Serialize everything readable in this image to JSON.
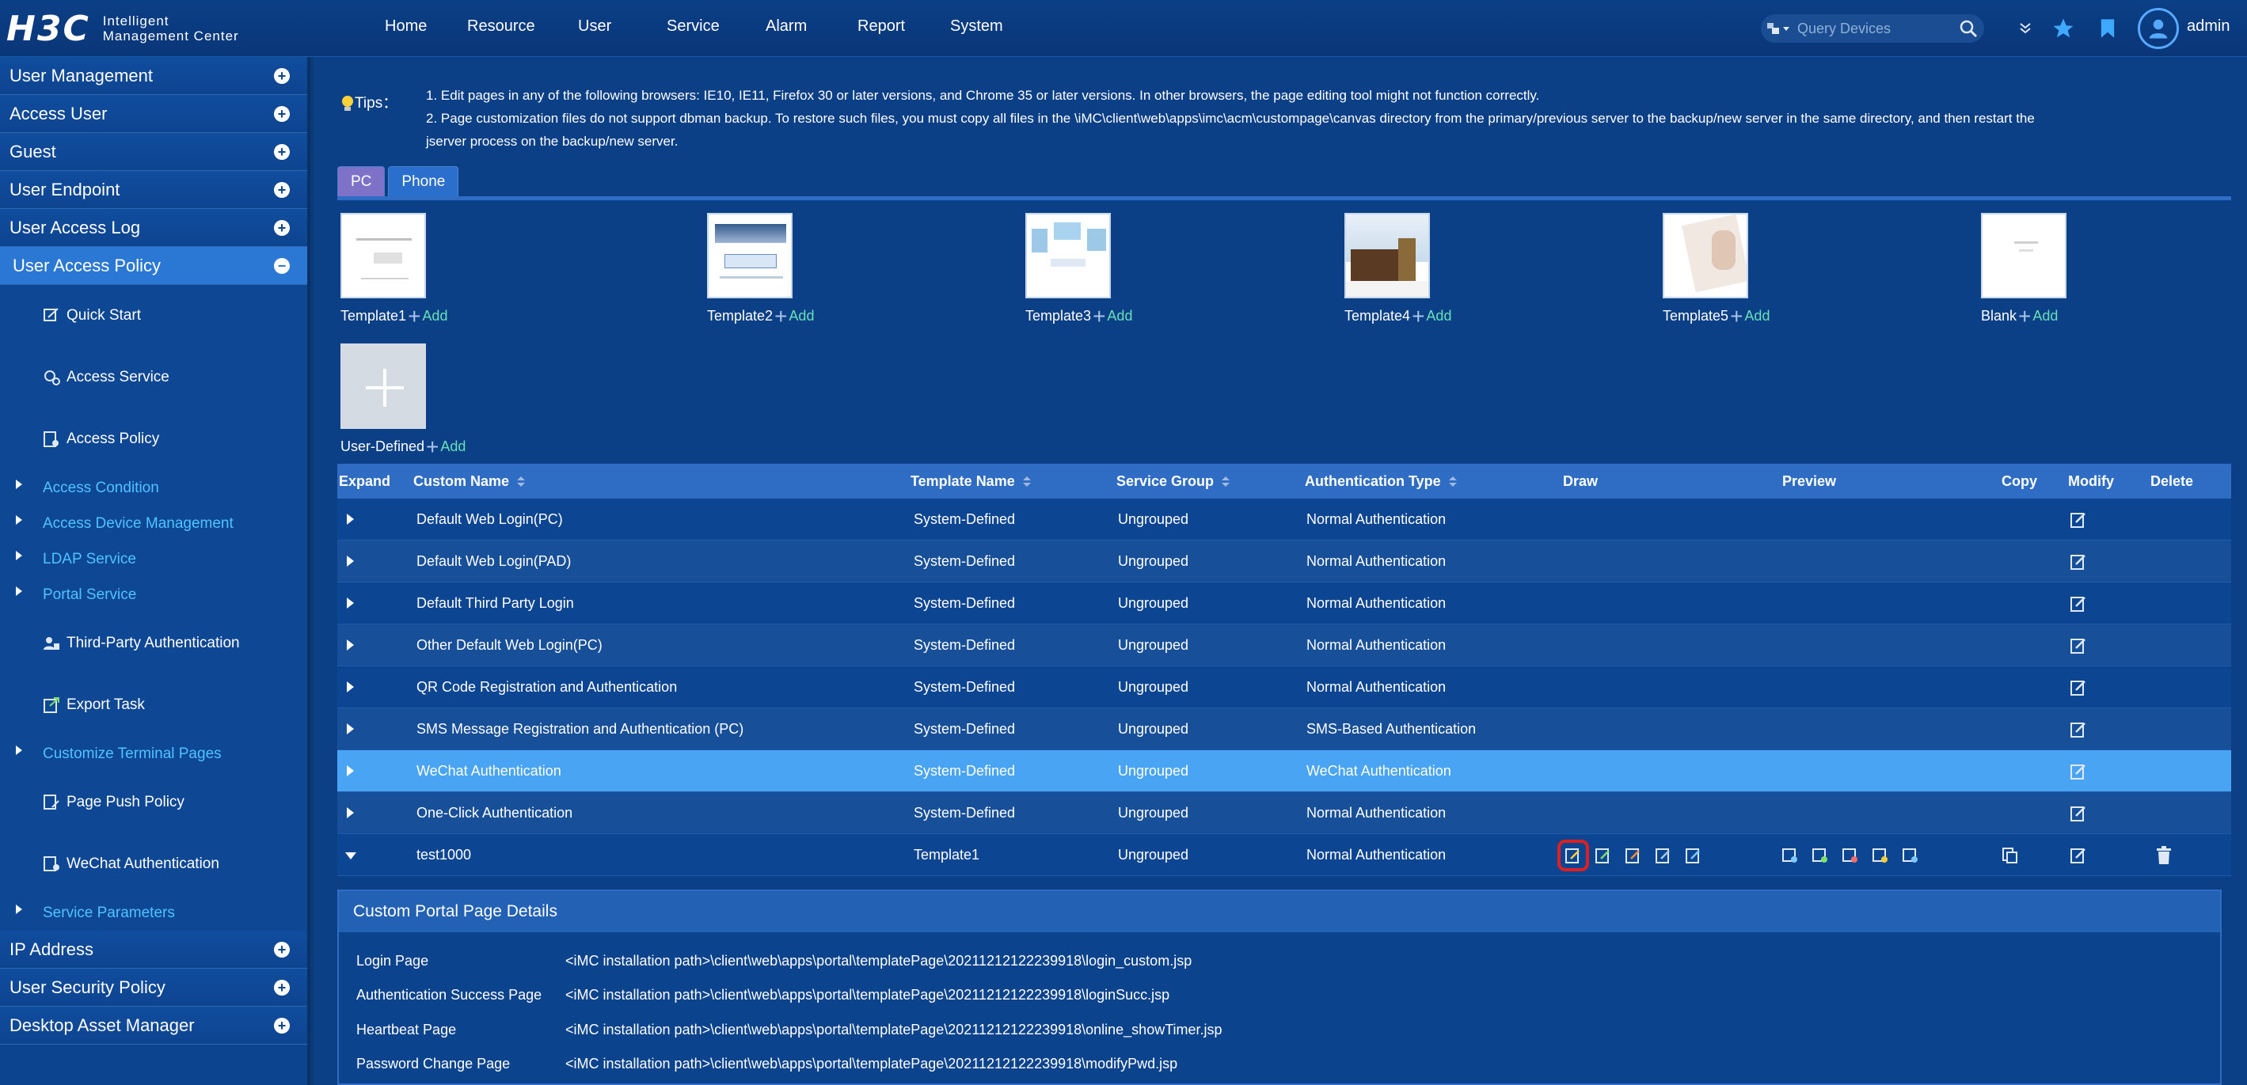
{
  "app": {
    "logo_mark": "H3C",
    "logo_line1": "Intelligent",
    "logo_line2": "Management Center"
  },
  "nav": [
    "Home",
    "Resource",
    "User",
    "Service",
    "Alarm",
    "Report",
    "System"
  ],
  "search": {
    "placeholder": "Query Devices"
  },
  "user": {
    "name": "admin"
  },
  "sidebar": {
    "top_menus": [
      "User Management",
      "Access User",
      "Guest",
      "User Endpoint",
      "User Access Log"
    ],
    "active_menu": "User Access Policy",
    "sub_items": [
      {
        "type": "item",
        "label": "Quick Start",
        "icon": "quick-start-icon"
      },
      {
        "type": "item",
        "label": "Access Service",
        "icon": "access-service-icon"
      },
      {
        "type": "item",
        "label": "Access Policy",
        "icon": "access-policy-icon"
      },
      {
        "type": "group",
        "label": "Access Condition"
      },
      {
        "type": "group",
        "label": "Access Device Management"
      },
      {
        "type": "group",
        "label": "LDAP Service"
      },
      {
        "type": "group",
        "label": "Portal Service"
      },
      {
        "type": "item",
        "label": "Third-Party Authentication",
        "icon": "third-party-auth-icon"
      },
      {
        "type": "item",
        "label": "Export Task",
        "icon": "export-task-icon"
      },
      {
        "type": "group",
        "label": "Customize Terminal Pages"
      },
      {
        "type": "item",
        "label": "Page Push Policy",
        "icon": "page-push-policy-icon"
      },
      {
        "type": "item",
        "label": "WeChat Authentication",
        "icon": "wechat-auth-icon"
      },
      {
        "type": "group",
        "label": "Service Parameters"
      }
    ],
    "bottom_menus": [
      "IP Address",
      "User Security Policy",
      "Desktop Asset Manager"
    ]
  },
  "tips": {
    "label": "Tips：",
    "line1": "1. Edit pages in any of the following browsers: IE10, IE11, Firefox 30 or later versions, and Chrome 35 or later versions. In other browsers, the page editing tool might not function correctly.",
    "line2": "2. Page customization files do not support dbman backup. To restore such files, you must copy all files in the \\iMC\\client\\web\\apps\\imc\\acm\\custompage\\canvas directory from the primary/previous server to the backup/new server in the same directory, and then restart the",
    "line3": "jserver process on the backup/new server."
  },
  "tabs": {
    "pc": "PC",
    "phone": "Phone"
  },
  "templates": [
    {
      "name": "Template1",
      "add": "Add"
    },
    {
      "name": "Template2",
      "add": "Add"
    },
    {
      "name": "Template3",
      "add": "Add"
    },
    {
      "name": "Template4",
      "add": "Add"
    },
    {
      "name": "Template5",
      "add": "Add"
    },
    {
      "name": "Blank",
      "add": "Add"
    },
    {
      "name": "User-Defined",
      "add": "Add"
    }
  ],
  "table": {
    "headers": {
      "expand": "Expand",
      "custom_name": "Custom Name",
      "template_name": "Template Name",
      "service_group": "Service Group",
      "auth_type": "Authentication Type",
      "draw": "Draw",
      "preview": "Preview",
      "copy": "Copy",
      "modify": "Modify",
      "delete": "Delete"
    },
    "rows": [
      {
        "name": "Default Web Login(PC)",
        "template": "System-Defined",
        "group": "Ungrouped",
        "auth": "Normal Authentication"
      },
      {
        "name": "Default Web Login(PAD)",
        "template": "System-Defined",
        "group": "Ungrouped",
        "auth": "Normal Authentication"
      },
      {
        "name": "Default Third Party Login",
        "template": "System-Defined",
        "group": "Ungrouped",
        "auth": "Normal Authentication"
      },
      {
        "name": "Other Default Web Login(PC)",
        "template": "System-Defined",
        "group": "Ungrouped",
        "auth": "Normal Authentication"
      },
      {
        "name": "QR Code Registration and Authentication",
        "template": "System-Defined",
        "group": "Ungrouped",
        "auth": "Normal Authentication"
      },
      {
        "name": "SMS Message Registration and Authentication (PC)",
        "template": "System-Defined",
        "group": "Ungrouped",
        "auth": "SMS-Based Authentication"
      },
      {
        "name": "WeChat Authentication",
        "template": "System-Defined",
        "group": "Ungrouped",
        "auth": "WeChat Authentication"
      },
      {
        "name": "One-Click Authentication",
        "template": "System-Defined",
        "group": "Ungrouped",
        "auth": "Normal Authentication"
      },
      {
        "name": "test1000",
        "template": "Template1",
        "group": "Ungrouped",
        "auth": "Normal Authentication"
      }
    ],
    "selected_row": "WeChat Authentication",
    "expanded_row": "test1000"
  },
  "details": {
    "title": "Custom Portal Page Details",
    "rows": [
      {
        "key": "Login Page",
        "value": "<iMC installation path>\\client\\web\\apps\\portal\\templatePage\\20211212122239918\\login_custom.jsp"
      },
      {
        "key": "Authentication Success Page",
        "value": "<iMC installation path>\\client\\web\\apps\\portal\\templatePage\\20211212122239918\\loginSucc.jsp"
      },
      {
        "key": "Heartbeat Page",
        "value": "<iMC installation path>\\client\\web\\apps\\portal\\templatePage\\20211212122239918\\online_showTimer.jsp"
      },
      {
        "key": "Password Change Page",
        "value": "<iMC installation path>\\client\\web\\apps\\portal\\templatePage\\20211212122239918\\modifyPwd.jsp"
      }
    ]
  },
  "colors": {
    "background": "#0b3f86",
    "accent": "#2f6dc4",
    "selected_row": "#4aa4f4",
    "link_cyan": "#4fc3ff",
    "add_green": "#66e0b8",
    "highlight_red": "#e02020"
  }
}
